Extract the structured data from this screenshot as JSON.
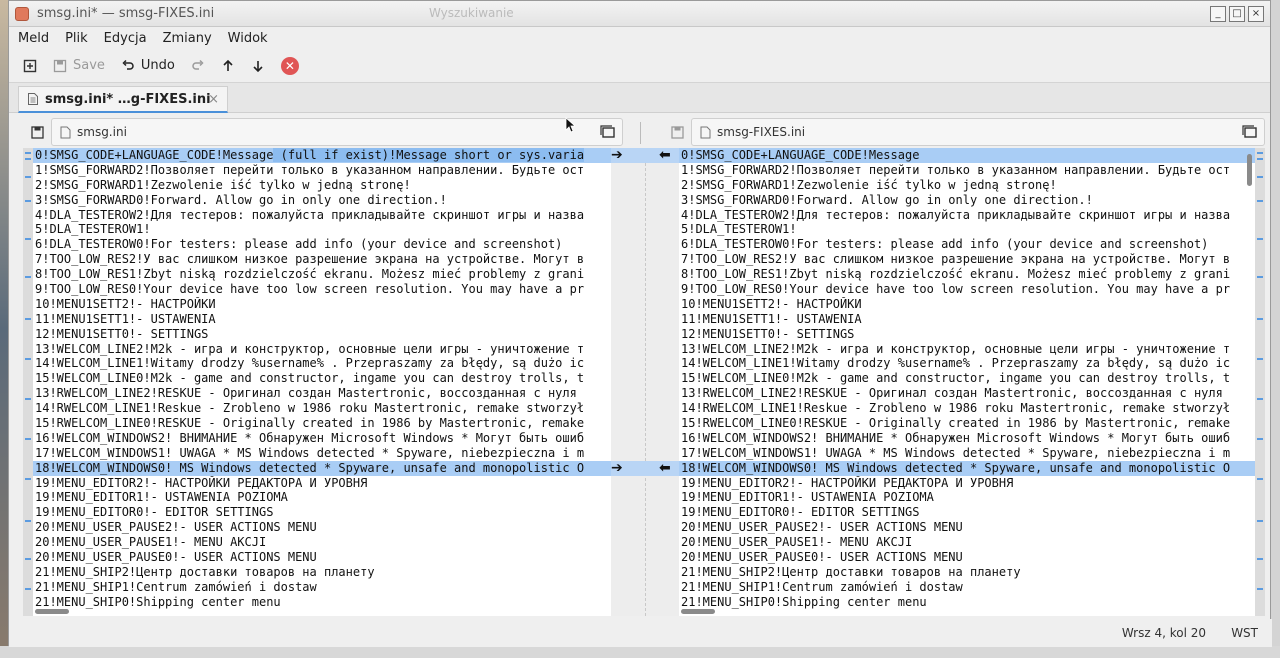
{
  "window": {
    "title": "smsg.ini* — smsg-FIXES.ini",
    "background_title": "Wyszukiwanie",
    "controls": [
      "_",
      "□",
      "×"
    ]
  },
  "menu": [
    "Meld",
    "Plik",
    "Edycja",
    "Zmiany",
    "Widok"
  ],
  "toolbar": {
    "new_icon": "new-comparison-icon",
    "save_label": "Save",
    "undo_label": "Undo",
    "redo_icon": "redo-icon",
    "up_icon": "previous-change-icon",
    "down_icon": "next-change-icon",
    "stop_icon": "stop-icon"
  },
  "tab": {
    "label": "smsg.ini* …g-FIXES.ini",
    "close": "×"
  },
  "left_file": "smsg.ini",
  "right_file": "smsg-FIXES.ini",
  "left_lines": [
    "0!SMSG_CODE+LANGUAGE_CODE!Message (full if exist)!Message short or sys.varia",
    "1!SMSG_FORWARD2!Позволяет перейти только в указанном направлении. Будьте ост",
    "2!SMSG_FORWARD1!Zezwolenie iść tylko w jedną stronę!",
    "3!SMSG_FORWARD0!Forward. Allow go in only one direction.!",
    "4!DLA_TESTEROW2!Для тестеров: пожалуйста прикладывайте скриншот игры и назва",
    "5!DLA_TESTEROW1!",
    "6!DLA_TESTEROW0!For testers: please add info (your device and screenshot)",
    "7!TOO_LOW_RES2!У вас слишком низкое разрешение экрана на устройстве. Могут в",
    "8!TOO_LOW_RES1!Zbyt niską rozdzielczość ekranu. Możesz mieć problemy z grani",
    "9!TOO_LOW_RES0!Your device have too low screen resolution. You may have a pr",
    "10!MENU1SETT2!- НАСТРОЙКИ",
    "11!MENU1SETT1!- USTAWENIA",
    "12!MENU1SETT0!- SETTINGS",
    "13!WELCOM_LINE2!M2k - игра и конструктор, основные цели игры - уничтожение т",
    "14!WELCOM_LINE1!Witamy drodzy %username% . Przepraszamy za błędy, są dużo ic",
    "15!WELCOM_LINE0!M2k - game and constructor, ingame you can destroy trolls, t",
    "13!RWELCOM_LINE2!RESKUE - Оригинал создан Mastertronic, воссозданная с нуля",
    "14!RWELCOM_LINE1!Reskue - Zroblenо w 1986 roku Mastertronic, remake stworzył",
    "15!RWELCOM_LINE0!RESKUE - Originally created in 1986 by Mastertronic, remake",
    "16!WELCOM_WINDOWS2! ВНИМАНИЕ * Обнаружен Microsoft Windows * Могут быть ошиб",
    "17!WELCOM_WINDOWS1! UWAGA * MS Windows detected * Spyware, niebezpieczna i m",
    "18!WELCOM_WINDOWS0! MS Windows detected * Spyware, unsafe and monopolistic O",
    "19!MENU_EDITOR2!- НАСТРОЙКИ РЕДАКТОРА И УРОВНЯ",
    "19!MENU_EDITOR1!- USTAWENIA POZIOMA",
    "19!MENU_EDITOR0!- EDITOR SETTINGS",
    "20!MENU_USER_PAUSE2!- USER ACTIONS MENU",
    "20!MENU_USER_PAUSE1!- MENU AKCJI",
    "20!MENU_USER_PAUSE0!- USER ACTIONS MENU",
    "21!MENU_SHIP2!Центр доставки товаров на планету",
    "21!MENU_SHIP1!Centrum zamówień i dostaw",
    "21!MENU_SHIP0!Shipping center menu"
  ],
  "right_lines": [
    "0!SMSG_CODE+LANGUAGE_CODE!Message",
    "1!SMSG_FORWARD2!Позволяет перейти только в указанном направлении. Будьте ост",
    "2!SMSG_FORWARD1!Zezwolenie iść tylko w jedną stronę!",
    "3!SMSG_FORWARD0!Forward. Allow go in only one direction.!",
    "4!DLA_TESTEROW2!Для тестеров: пожалуйста прикладывайте скриншот игры и назва",
    "5!DLA_TESTEROW1!",
    "6!DLA_TESTEROW0!For testers: please add info (your device and screenshot)",
    "7!TOO_LOW_RES2!У вас слишком низкое разрешение экрана на устройстве. Могут в",
    "8!TOO_LOW_RES1!Zbyt niską rozdzielczość ekranu. Możesz mieć problemy z grani",
    "9!TOO_LOW_RES0!Your device have too low screen resolution. You may have a pr",
    "10!MENU1SETT2!- НАСТРОЙКИ",
    "11!MENU1SETT1!- USTAWENIA",
    "12!MENU1SETT0!- SETTINGS",
    "13!WELCOM_LINE2!M2k - игра и конструктор, основные цели игры - уничтожение т",
    "14!WELCOM_LINE1!Witamy drodzy %username% . Przepraszamy za błędy, są dużo ic",
    "15!WELCOM_LINE0!M2k - game and constructor, ingame you can destroy trolls, t",
    "13!RWELCOM_LINE2!RESKUE - Оригинал создан Mastertronic, воссозданная с нуля",
    "14!RWELCOM_LINE1!Reskue - Zroblenо w 1986 roku Mastertronic, remake stworzył",
    "15!RWELCOM_LINE0!RESKUE - Originally created in 1986 by Mastertronic, remake",
    "16!WELCOM_WINDOWS2! ВНИМАНИЕ * Обнаружен Microsoft Windows * Могут быть ошиб",
    "17!WELCOM_WINDOWS1! UWAGA * MS Windows detected * Spyware, niebezpieczna i m",
    "18!WELCOM_WINDOWS0! MS Windows detected * Spyware, unsafe and monopolistic O",
    "19!MENU_EDITOR2!- НАСТРОЙКИ РЕДАКТОРА И УРОВНЯ",
    "19!MENU_EDITOR1!- USTAWENIA POZIOMA",
    "19!MENU_EDITOR0!- EDITOR SETTINGS",
    "20!MENU_USER_PAUSE2!- USER ACTIONS MENU",
    "20!MENU_USER_PAUSE1!- MENU AKCJI",
    "20!MENU_USER_PAUSE0!- USER ACTIONS MENU",
    "21!MENU_SHIP2!Центр доставки товаров на планету",
    "21!MENU_SHIP1!Centrum zamówień i dostaw",
    "21!MENU_SHIP0!Shipping center menu"
  ],
  "changed_lines": [
    0,
    21
  ],
  "status": {
    "position": "Wrsz 4, kol 20",
    "mode": "WST"
  },
  "colors": {
    "change_highlight": "#a9cdf5",
    "inline_highlight": "#8cbcf0",
    "stop_button": "#e05555"
  }
}
